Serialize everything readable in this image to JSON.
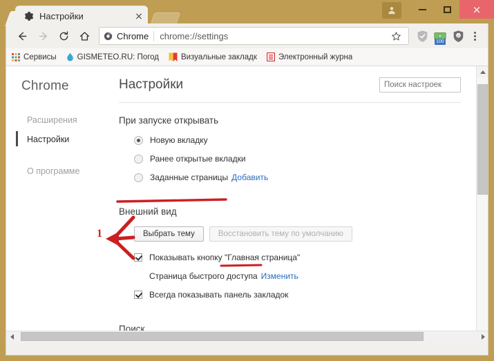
{
  "window": {
    "avatar_icon": "user-avatar-icon",
    "minimize_label": "minimize",
    "maximize_label": "maximize",
    "close_label": "×"
  },
  "tab": {
    "favicon": "gear-icon",
    "title": "Настройки",
    "close_label": "×"
  },
  "toolbar": {
    "back_icon": "arrow-left-icon",
    "forward_icon": "arrow-right-icon",
    "reload_icon": "reload-icon",
    "home_icon": "home-icon",
    "chrome_badge_label": "Chrome",
    "url": "chrome://settings",
    "star_icon": "star-icon",
    "extensions": [
      {
        "name": "shield-grey-icon",
        "badge": ""
      },
      {
        "name": "money-green-icon",
        "badge": "100"
      },
      {
        "name": "shield-dark-icon",
        "badge": ""
      }
    ],
    "menu_icon": "three-dot-menu-icon"
  },
  "bookmarks": [
    {
      "icon": "apps-grid-icon",
      "label": "Сервисы"
    },
    {
      "icon": "water-drop-icon",
      "label": "GISMETEO.RU: Погод"
    },
    {
      "icon": "bookmark-yellow-icon",
      "label": "Визуальные закладк"
    },
    {
      "icon": "document-red-icon",
      "label": "Электронный журна"
    }
  ],
  "sidebar": {
    "brand": "Chrome",
    "items": [
      {
        "label": "Расширения",
        "selected": false
      },
      {
        "label": "Настройки",
        "selected": true
      },
      {
        "label": "О программе",
        "selected": false
      }
    ]
  },
  "content": {
    "page_title": "Настройки",
    "search_placeholder": "Поиск настроек",
    "startup": {
      "title": "При запуске открывать",
      "options": [
        {
          "label": "Новую вкладку",
          "checked": true,
          "link": ""
        },
        {
          "label": "Ранее открытые вкладки",
          "checked": false,
          "link": ""
        },
        {
          "label": "Заданные страницы",
          "checked": false,
          "link": "Добавить"
        }
      ]
    },
    "appearance": {
      "title": "Внешний вид",
      "choose_theme_button": "Выбрать тему",
      "reset_theme_button": "Восстановить тему по умолчанию",
      "show_home_button": "Показывать кнопку \"Главная страница\"",
      "quick_access_label": "Страница быстрого доступа",
      "quick_access_link": "Изменить",
      "always_show_bookmarks": "Всегда показывать панель закладок"
    },
    "search_section_title": "Поиск"
  },
  "annotation": {
    "step_number": "1",
    "color": "#cc1f22"
  }
}
